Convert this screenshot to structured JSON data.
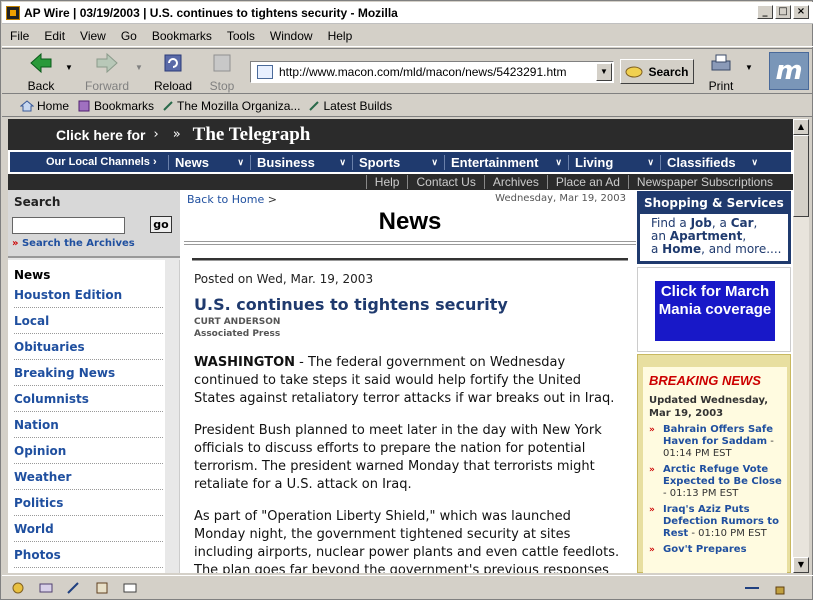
{
  "window": {
    "title": "AP Wire | 03/19/2003 | U.S. continues to tightens security - Mozilla"
  },
  "menu": [
    "File",
    "Edit",
    "View",
    "Go",
    "Bookmarks",
    "Tools",
    "Window",
    "Help"
  ],
  "nav": {
    "back": "Back",
    "forward": "Forward",
    "reload": "Reload",
    "stop": "Stop",
    "search": "Search",
    "print": "Print",
    "url": "http://www.macon.com/mld/macon/news/5423291.htm"
  },
  "bookmarks": [
    "Home",
    "Bookmarks",
    "The Mozilla Organiza...",
    "Latest Builds"
  ],
  "site": {
    "click_here": "Click here for",
    "paper": "The Telegraph",
    "local_channels": "Our Local Channels",
    "channels": [
      "News",
      "Business",
      "Sports",
      "Entertainment",
      "Living",
      "Classifieds"
    ],
    "util": [
      "Help",
      "Contact Us",
      "Archives",
      "Place an Ad",
      "Newspaper Subscriptions"
    ],
    "search": {
      "heading": "Search",
      "go": "go",
      "archives": "Search the Archives"
    },
    "left_nav_title": "News",
    "left_nav": [
      "Houston Edition",
      "Local",
      "Obituaries",
      "Breaking News",
      "Columnists",
      "Nation",
      "Opinion",
      "Weather",
      "Politics",
      "World",
      "Photos"
    ],
    "back_home": "Back to Home",
    "date": "Wednesday, Mar 19, 2003",
    "section": "News"
  },
  "article": {
    "posted": "Posted on Wed, Mar. 19, 2003",
    "headline": "U.S. continues to tightens security",
    "author": "CURT ANDERSON",
    "agency": "Associated Press",
    "dateline": "WASHINGTON",
    "p1": " - The federal government on Wednesday continued to take steps it said would help fortify the United States against retaliatory terror attacks if war breaks out in Iraq.",
    "p2": "President Bush planned to meet later in the day with New York officials to discuss efforts to prepare the nation for potential terrorism. The president warned Monday that terrorists might retaliate for a U.S. attack on Iraq.",
    "p3": "As part of \"Operation Liberty Shield,\" which was launched Monday night, the government tightened security at sites including airports, nuclear power plants and even cattle feedlots. The plan goes far beyond the government's previous responses to threats of terror because officials believe war with Iraq increases the possibility of"
  },
  "right": {
    "shop_heading": "Shopping & Services",
    "shop": {
      "find": "Find a ",
      "job": "Job",
      "sep1": ", a ",
      "car": "Car",
      "sep2": ",",
      "an": "an ",
      "apartment": "Apartment",
      "sep3": ",",
      "a": "a ",
      "home": "Home",
      "more": ", and more...."
    },
    "promo": "Click for March Mania coverage",
    "breaking_heading": "BREAKING NEWS",
    "updated": "Updated Wednesday, Mar 19, 2003",
    "items": [
      {
        "title": "Bahrain Offers Safe Haven for Saddam",
        "time": " - 01:14 PM EST"
      },
      {
        "title": "Arctic Refuge Vote Expected to Be Close",
        "time": " - 01:13 PM EST"
      },
      {
        "title": "Iraq's Aziz Puts Defection Rumors to Rest",
        "time": " - 01:10 PM EST"
      },
      {
        "title": "Gov't Prepares",
        "time": ""
      }
    ]
  }
}
